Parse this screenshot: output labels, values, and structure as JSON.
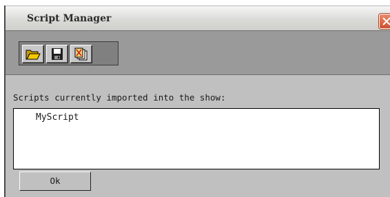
{
  "window": {
    "title": "Script Manager"
  },
  "toolbar": {
    "buttons": [
      {
        "icon": "open-folder-icon",
        "label": ""
      },
      {
        "icon": "save-disk-icon",
        "label": ""
      },
      {
        "icon": "remove-script-icon",
        "label": ""
      }
    ]
  },
  "main": {
    "prompt": "Scripts currently imported into the show:",
    "scripts": [
      "MyScript"
    ],
    "ok_label": "Ok"
  },
  "colors": {
    "chrome": "#c0c0c0",
    "toolbar_band": "#9a9a9a",
    "close_button": "#d96a48",
    "folder_yellow": "#f0c000"
  }
}
